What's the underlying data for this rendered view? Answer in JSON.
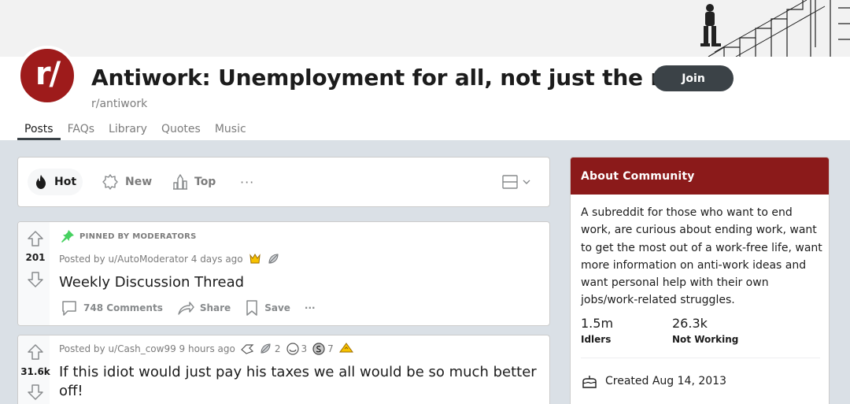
{
  "subreddit": {
    "title": "Antiwork: Unemployment for all, not just the rich!",
    "name": "r/antiwork",
    "avatar_text": "r/",
    "join_label": "Join"
  },
  "tabs": [
    {
      "label": "Posts",
      "active": true
    },
    {
      "label": "FAQs"
    },
    {
      "label": "Library"
    },
    {
      "label": "Quotes"
    },
    {
      "label": "Music"
    }
  ],
  "sort": {
    "hot": "Hot",
    "new": "New",
    "top": "Top",
    "more": "···"
  },
  "posts": [
    {
      "pinned_label": "PINNED BY MODERATORS",
      "votes": "201",
      "meta": "Posted by u/AutoModerator 4 days ago",
      "title": "Weekly Discussion Thread",
      "comments": "748 Comments",
      "share": "Share",
      "save": "Save",
      "more": "···"
    },
    {
      "votes": "31.6k",
      "meta": "Posted by u/Cash_cow99 9 hours ago",
      "awards": [
        "2",
        "3",
        "7"
      ],
      "title_line1": "If this idiot would just pay his taxes we all would be so much better",
      "title_line2": "off!"
    }
  ],
  "about": {
    "heading": "About Community",
    "description": "A subreddit for those who want to end work, are curious about ending work, want to get the most out of a work-free life, want more information on anti-work ideas and want personal help with their own jobs/work-related struggles.",
    "members_value": "1.5m",
    "members_label": "Idlers",
    "online_value": "26.3k",
    "online_label": "Not Working",
    "created": "Created Aug 14, 2013"
  },
  "colors": {
    "brand": "#9e1b1b",
    "about_header": "#8b1a1a",
    "join_button": "#3b4247",
    "pinned_icon": "#46d160"
  }
}
